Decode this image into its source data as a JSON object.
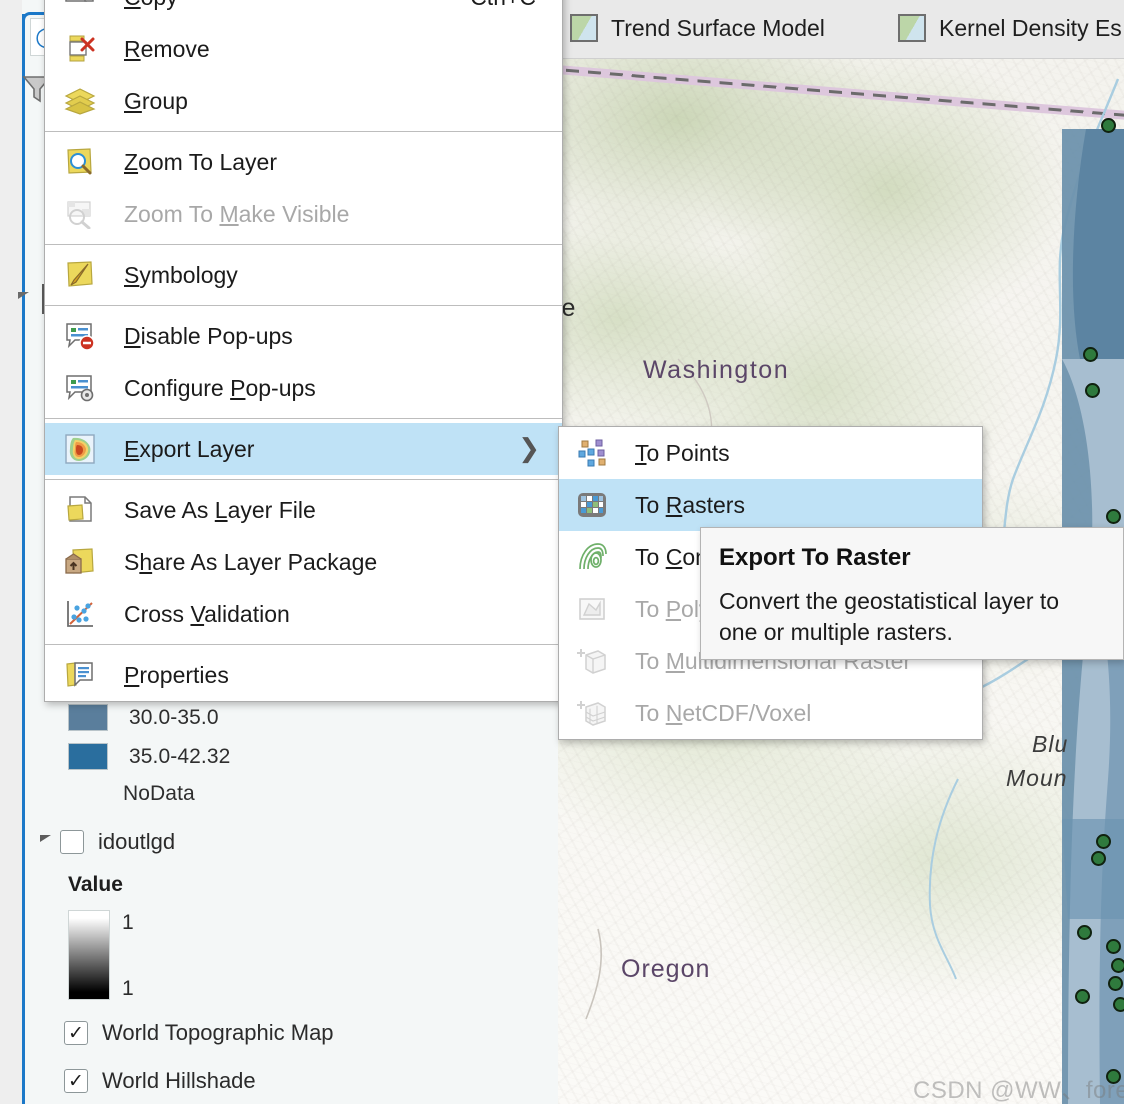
{
  "app": {
    "watermark": "CSDN @WW、forever"
  },
  "contents_pane": {
    "search_icon": "search-icon",
    "filter_icon": "filter-icon",
    "legend_classes": [
      {
        "label": "30.0-35.0",
        "color": "#5a7e9c"
      },
      {
        "label": "35.0-42.32",
        "color": "#2a6e9e"
      }
    ],
    "nodata_label": "NoData",
    "layers": [
      {
        "name": "idoutlgd",
        "checked": false,
        "expandable": true
      },
      {
        "name": "World Topographic Map",
        "checked": true,
        "expandable": false
      },
      {
        "name": "World Hillshade",
        "checked": true,
        "expandable": false
      }
    ],
    "value_header": "Value",
    "ramp_top_value": "1",
    "ramp_bottom_value": "1"
  },
  "map": {
    "tabs": [
      {
        "label": "Trend Surface Model"
      },
      {
        "label": "Kernel Density Es"
      }
    ],
    "labels": {
      "seattle": "ttle",
      "washington": "Washington",
      "oregon": "Oregon",
      "blue_line1": "Blu",
      "blue_line2": "Moun"
    }
  },
  "context_menu": {
    "items": [
      {
        "label": "Copy",
        "accel": "Ctrl+C",
        "icon": "copy-icon",
        "mnemonic": "C",
        "disabled": false,
        "separator_after": false
      },
      {
        "label": "Remove",
        "accel": "",
        "icon": "remove-layer-icon",
        "mnemonic": "R",
        "disabled": false,
        "separator_after": false
      },
      {
        "label": "Group",
        "accel": "",
        "icon": "group-layers-icon",
        "mnemonic": "G",
        "disabled": false,
        "separator_after": true
      },
      {
        "label": "Zoom To Layer",
        "accel": "",
        "icon": "zoom-to-layer-icon",
        "mnemonic": "Z",
        "disabled": false,
        "separator_after": false
      },
      {
        "label": "Zoom To Make Visible",
        "accel": "",
        "icon": "zoom-make-visible-icon",
        "mnemonic": "M",
        "disabled": true,
        "separator_after": true
      },
      {
        "label": "Symbology",
        "accel": "",
        "icon": "symbology-icon",
        "mnemonic": "S",
        "disabled": false,
        "separator_after": true
      },
      {
        "label": "Disable Pop-ups",
        "accel": "",
        "icon": "disable-popups-icon",
        "mnemonic": "D",
        "disabled": false,
        "separator_after": false
      },
      {
        "label": "Configure Pop-ups",
        "accel": "",
        "icon": "configure-popups-icon",
        "mnemonic": "P",
        "disabled": false,
        "separator_after": true
      },
      {
        "label": "Export Layer",
        "accel": "",
        "icon": "export-layer-icon",
        "mnemonic": "E",
        "disabled": false,
        "selected": true,
        "submenu": true,
        "separator_after": true
      },
      {
        "label": "Save As Layer File",
        "accel": "",
        "icon": "save-layer-file-icon",
        "mnemonic": "L",
        "disabled": false,
        "separator_after": false
      },
      {
        "label": "Share As Layer Package",
        "accel": "",
        "icon": "share-layer-package-icon",
        "mnemonic": "h",
        "disabled": false,
        "separator_after": false
      },
      {
        "label": "Cross Validation",
        "accel": "",
        "icon": "cross-validation-icon",
        "mnemonic": "V",
        "disabled": false,
        "separator_after": true
      },
      {
        "label": "Properties",
        "accel": "",
        "icon": "properties-icon",
        "mnemonic": "P",
        "disabled": false,
        "separator_after": false
      }
    ]
  },
  "submenu": {
    "items": [
      {
        "label": "To Points",
        "icon": "to-points-icon",
        "mnemonic": "T",
        "disabled": false,
        "selected": false
      },
      {
        "label": "To Rasters",
        "icon": "to-rasters-icon",
        "mnemonic": "R",
        "disabled": false,
        "selected": true
      },
      {
        "label": "To Contour",
        "icon": "to-contour-icon",
        "mnemonic": "C",
        "disabled": false,
        "selected": false
      },
      {
        "label": "To Polygon",
        "icon": "to-polygon-icon",
        "mnemonic": "P",
        "disabled": true,
        "selected": false
      },
      {
        "label": "To Multidimensional Raster",
        "icon": "to-multidimensional-raster-icon",
        "mnemonic": "M",
        "disabled": true,
        "selected": false
      },
      {
        "label": "To NetCDF/Voxel",
        "icon": "to-netcdf-voxel-icon",
        "mnemonic": "N",
        "disabled": true,
        "selected": false
      }
    ]
  },
  "tooltip": {
    "title": "Export To Raster",
    "body": "Convert the geostatistical layer to one or multiple rasters."
  },
  "colors": {
    "selection_blue": "#bfe2f6",
    "accent_blue": "#1b78c8",
    "menu_bg": "#ffffff",
    "pane_bg": "#f4f7f7",
    "tab_bg": "#e9e9e9",
    "point_green": "#2f7a3d"
  }
}
